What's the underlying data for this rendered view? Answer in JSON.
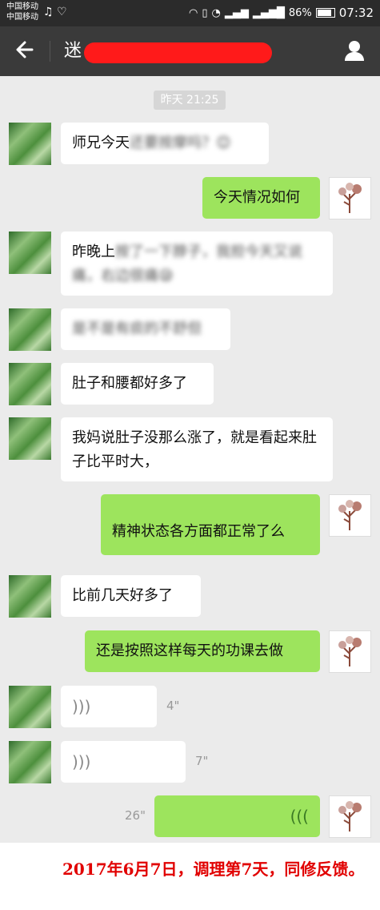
{
  "status_bar": {
    "carrier1": "中国移动",
    "carrier2": "中国移动",
    "battery": "86%",
    "time": "07:32",
    "icons": [
      "music-note-icon",
      "heart-icon",
      "headphones-icon",
      "vibrate-icon",
      "wifi-icon",
      "signal-2g-icon",
      "signal-4g-icon",
      "battery-icon"
    ]
  },
  "header": {
    "title_visible": "迷",
    "back_icon": "back-arrow-icon",
    "profile_icon": "user-icon"
  },
  "timestamp": "昨天 21:25",
  "messages": [
    {
      "side": "in",
      "text": "师兄今天",
      "blurred": "还要按摩吗？😊"
    },
    {
      "side": "out",
      "text": "今天情况如何"
    },
    {
      "side": "in",
      "text": "昨晚上",
      "blurred": "按了一下脖子，我担今天又说痛，右边很痛😪"
    },
    {
      "side": "in",
      "text": "",
      "blurred": "是不是有痰的不舒但"
    },
    {
      "side": "in",
      "text": "肚子和腰都好多了"
    },
    {
      "side": "in",
      "text": "我妈说肚子没那么涨了，就是看起来肚子比平时大，"
    },
    {
      "side": "out",
      "text": "精神状态各方面都正常了么"
    },
    {
      "side": "in",
      "text": "比前几天好多了"
    },
    {
      "side": "out",
      "text": "还是按照这样每天的功课去做"
    },
    {
      "side": "in",
      "voice": "4\""
    },
    {
      "side": "in",
      "voice": "7\""
    },
    {
      "side": "out",
      "voice": "26\""
    }
  ],
  "colors": {
    "outgoing_bubble": "#9de45d",
    "incoming_bubble": "#ffffff",
    "footer_text": "#e10000"
  },
  "footer": {
    "caption": "2017年6月7日，调理第7天，同修反馈。"
  }
}
